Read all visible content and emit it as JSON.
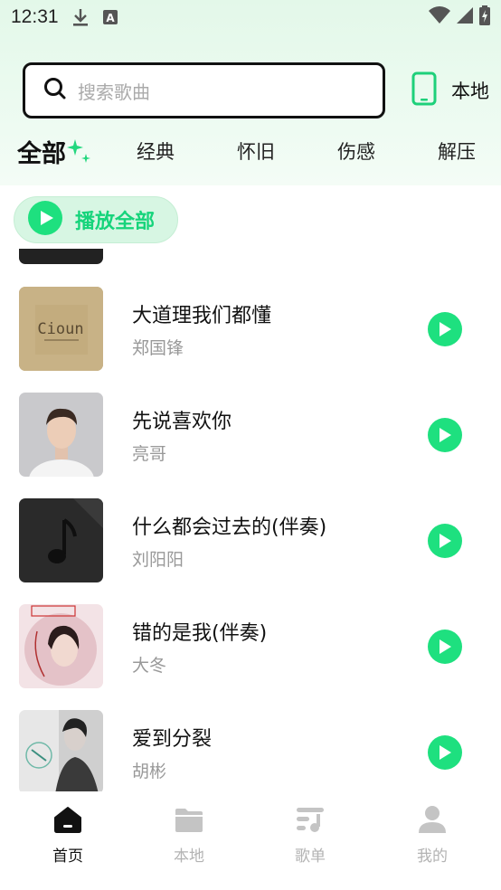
{
  "status_bar": {
    "time": "12:31",
    "icons": [
      "download-icon",
      "keyboard-a-icon",
      "wifi-icon",
      "signal-icon",
      "battery-charging-icon"
    ]
  },
  "search": {
    "placeholder": "搜索歌曲",
    "icon": "search-icon"
  },
  "local_button": {
    "label": "本地",
    "icon": "phone-icon"
  },
  "tabs": [
    {
      "label": "全部",
      "active": true
    },
    {
      "label": "经典",
      "active": false
    },
    {
      "label": "怀旧",
      "active": false
    },
    {
      "label": "伤感",
      "active": false
    },
    {
      "label": "解压",
      "active": false
    }
  ],
  "play_all": {
    "label": "播放全部",
    "icon": "play-circle-icon"
  },
  "songs": [
    {
      "title": "大道理我们都懂",
      "artist": "郑国锋",
      "cover_text": "Cioun"
    },
    {
      "title": "先说喜欢你",
      "artist": "亮哥"
    },
    {
      "title": "什么都会过去的(伴奏)",
      "artist": "刘阳阳"
    },
    {
      "title": "错的是我(伴奏)",
      "artist": "大冬"
    },
    {
      "title": "爱到分裂",
      "artist": "胡彬"
    }
  ],
  "bottom_nav": [
    {
      "label": "首页",
      "icon": "home-icon",
      "active": true
    },
    {
      "label": "本地",
      "icon": "folder-icon",
      "active": false
    },
    {
      "label": "歌单",
      "icon": "playlist-icon",
      "active": false
    },
    {
      "label": "我的",
      "icon": "user-icon",
      "active": false
    }
  ],
  "colors": {
    "accent": "#1ee07f",
    "accent_text": "#16d47b",
    "play_all_bg": "#d7f6e3",
    "header_bg": "#e3f8e9"
  }
}
